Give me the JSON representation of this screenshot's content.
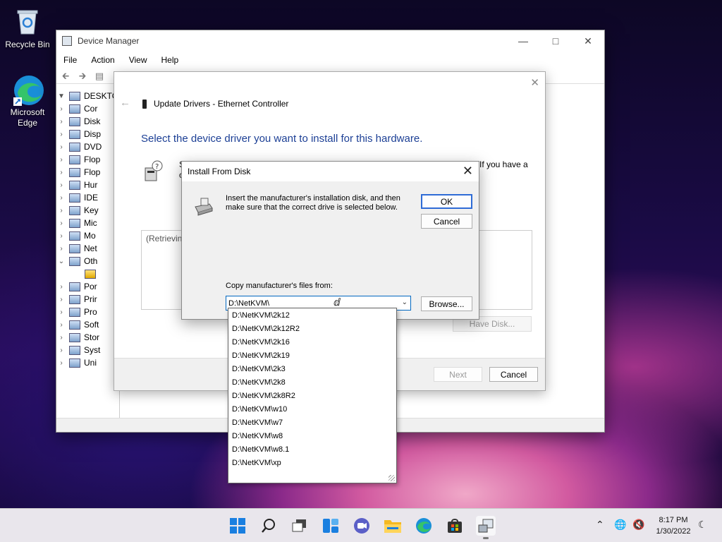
{
  "desktop": {
    "icons": [
      {
        "label": "Recycle Bin"
      },
      {
        "label": "Microsoft Edge"
      }
    ]
  },
  "device_manager": {
    "title": "Device Manager",
    "menu": [
      "File",
      "Action",
      "View",
      "Help"
    ],
    "tree": {
      "root": "DESKTO",
      "items": [
        "Cor",
        "Disk",
        "Disp",
        "DVD",
        "Flop",
        "Flop",
        "Hur",
        "IDE",
        "Key",
        "Mic",
        "Mo",
        "Net",
        "Oth",
        "",
        "Por",
        "Prir",
        "Pro",
        "Soft",
        "Stor",
        "Syst",
        "Uni"
      ]
    }
  },
  "wizard": {
    "title": "Update Drivers - Ethernet Controller",
    "heading": "Select the device driver you want to install for this hardware.",
    "info_fragment_1": "If you have a",
    "info_fragment_2": "S",
    "info_fragment_3": "c",
    "list_placeholder": "(Retrievin",
    "have_disk_label": "Have Disk...",
    "next_label": "Next",
    "cancel_label": "Cancel"
  },
  "install_from_disk": {
    "title": "Install From Disk",
    "instructions": "Insert the manufacturer's installation disk, and then make sure that the correct drive is selected below.",
    "ok_label": "OK",
    "cancel_label": "Cancel",
    "copy_label": "Copy manufacturer's files from:",
    "combo_value": "D:\\NetKVM\\",
    "browse_label": "Browse...",
    "options": [
      "D:\\NetKVM\\2k12",
      "D:\\NetKVM\\2k12R2",
      "D:\\NetKVM\\2k16",
      "D:\\NetKVM\\2k19",
      "D:\\NetKVM\\2k3",
      "D:\\NetKVM\\2k8",
      "D:\\NetKVM\\2k8R2",
      "D:\\NetKVM\\w10",
      "D:\\NetKVM\\w7",
      "D:\\NetKVM\\w8",
      "D:\\NetKVM\\w8.1",
      "D:\\NetKVM\\xp"
    ]
  },
  "taskbar": {
    "icons": [
      "start-icon",
      "search-icon",
      "task-view-icon",
      "widgets-icon",
      "chat-icon",
      "file-explorer-icon",
      "edge-icon",
      "store-icon",
      "device-manager-icon"
    ],
    "time": "8:17 PM",
    "date": "1/30/2022"
  },
  "colors": {
    "accent": "#0067c0",
    "heading_blue": "#1c3f95",
    "taskbar_bg": "#e9e6ec"
  }
}
